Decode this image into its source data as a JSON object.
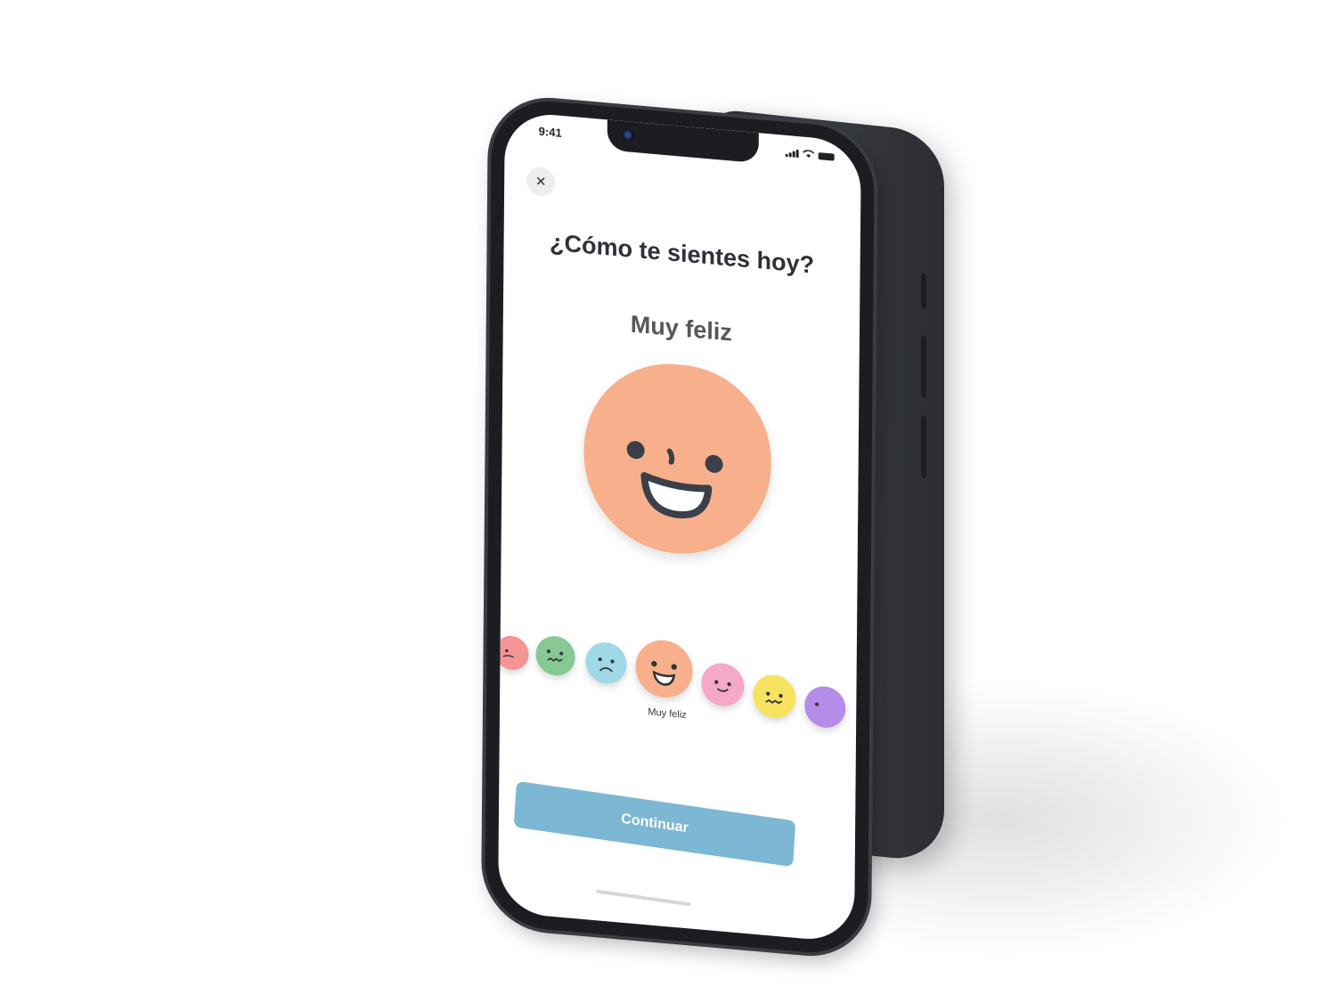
{
  "status_bar": {
    "time": "9:41"
  },
  "header": {
    "close_icon": "close-icon",
    "title": "¿Cómo te sientes hoy?"
  },
  "selected_mood": {
    "label": "Muy feliz",
    "color": "#f7b08b"
  },
  "moods": [
    {
      "name": "red",
      "color": "#f59494"
    },
    {
      "name": "green",
      "color": "#86c995"
    },
    {
      "name": "blue",
      "color": "#9fd8e6"
    },
    {
      "name": "orange",
      "color": "#f7b08b",
      "selected": true
    },
    {
      "name": "pink",
      "color": "#f6a8c8"
    },
    {
      "name": "yellow",
      "color": "#f7e35f"
    },
    {
      "name": "purple",
      "color": "#b58ce8"
    }
  ],
  "selected_label": "Muy feliz",
  "primary_button": {
    "label": "Continuar",
    "color": "#7cb7d4"
  }
}
